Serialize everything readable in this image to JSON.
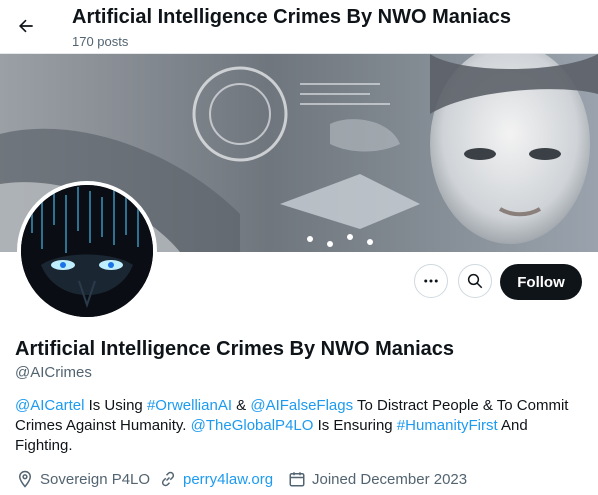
{
  "header": {
    "title": "Artificial Intelligence Crimes By NWO Maniacs",
    "posts": "170 posts"
  },
  "actions": {
    "follow_label": "Follow"
  },
  "profile": {
    "name": "Artificial Intelligence Crimes By NWO Maniacs",
    "handle": "@AICrimes",
    "bio": [
      {
        "text": "@AICartel",
        "link": true
      },
      {
        "text": " Is Using ",
        "link": false
      },
      {
        "text": "#OrwellianAI",
        "link": true
      },
      {
        "text": " & ",
        "link": false
      },
      {
        "text": "@AIFalseFlags",
        "link": true
      },
      {
        "text": " To Distract People & To Commit Crimes Against Humanity. ",
        "link": false
      },
      {
        "text": "@TheGlobalP4LO",
        "link": true
      },
      {
        "text": " Is Ensuring ",
        "link": false
      },
      {
        "text": "#HumanityFirst",
        "link": true
      },
      {
        "text": " And Fighting.",
        "link": false
      }
    ],
    "location": "Sovereign P4LO",
    "website": "perry4law.org",
    "joined": "Joined December 2023"
  },
  "icons": [
    "back-arrow-icon",
    "more-icon",
    "search-icon",
    "location-pin-icon",
    "link-icon",
    "calendar-icon"
  ],
  "colors": {
    "accent": "#1d9bf0",
    "text": "#0f1419",
    "secondary": "#536471",
    "follow_bg": "#0f1419"
  }
}
